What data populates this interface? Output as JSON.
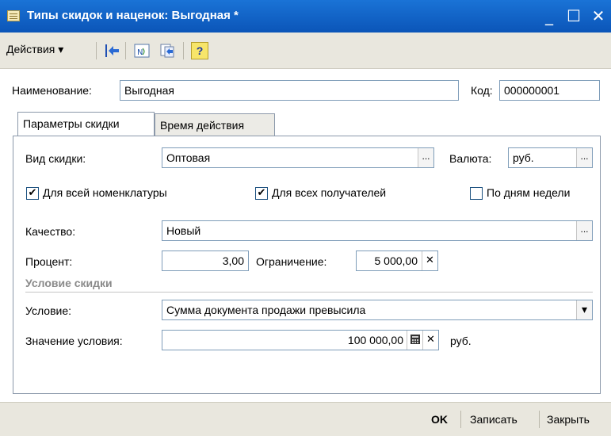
{
  "window": {
    "title": "Типы скидок и наценок: Выгодная *",
    "minimize": "_",
    "maximize": "☐",
    "close": "✕"
  },
  "toolbar": {
    "actions_label": "Действия",
    "actions_arrow": "▾",
    "icons": [
      "go-back-icon",
      "calendar-structure-icon",
      "transfer-icon",
      "help-icon"
    ],
    "help_label": "?"
  },
  "header": {
    "name_label": "Наименование:",
    "name_value": "Выгодная",
    "code_label": "Код:",
    "code_value": "000000001"
  },
  "tabs": [
    {
      "label": "Параметры скидки",
      "active": true
    },
    {
      "label": "Время действия",
      "active": false
    }
  ],
  "form": {
    "discount_type_label": "Вид скидки:",
    "discount_type_value": "Оптовая",
    "currency_label": "Валюта:",
    "currency_value": "руб.",
    "select_button": "...",
    "check_all_nomenclature": {
      "label": "Для всей номенклатуры",
      "checked": true
    },
    "check_all_recipients": {
      "label": "Для всех получателей",
      "checked": true
    },
    "check_weekdays": {
      "label": "По дням недели",
      "checked": false
    },
    "check_mark": "✔",
    "quality_label": "Качество:",
    "quality_value": "Новый",
    "percent_label": "Процент:",
    "percent_value": "3,00",
    "limit_label": "Ограничение:",
    "limit_value": "5 000,00",
    "clear_symbol": "✕",
    "section_title": "Условие скидки",
    "condition_label": "Условие:",
    "condition_value": "Сумма документа продажи превысила",
    "dropdown_arrow": "▾",
    "condition_value_label": "Значение условия:",
    "condition_amount": "100 000,00",
    "condition_unit": "руб."
  },
  "footer": {
    "ok_label": "OK",
    "save_label": "Записать",
    "close_label": "Закрыть"
  },
  "colors": {
    "titlebar": "#0b55b8",
    "toolbar": "#e9e7de",
    "field_border": "#7f9db9"
  }
}
